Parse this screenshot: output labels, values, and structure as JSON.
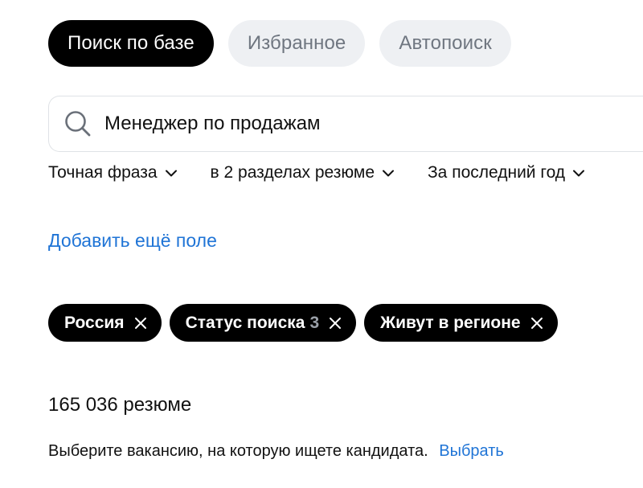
{
  "tabs": [
    {
      "label": "Поиск по базе",
      "active": true
    },
    {
      "label": "Избранное",
      "active": false
    },
    {
      "label": "Автопоиск",
      "active": false
    }
  ],
  "search": {
    "value": "Менеджер по продажам",
    "icon": "search-icon"
  },
  "filters": [
    {
      "label": "Точная фраза",
      "icon": "chevron-down-icon"
    },
    {
      "label": "в 2 разделах резюме",
      "icon": "chevron-down-icon"
    },
    {
      "label": "За последний год",
      "icon": "chevron-down-icon"
    }
  ],
  "add_field_label": "Добавить ещё поле",
  "chips": [
    {
      "label": "Россия",
      "count": ""
    },
    {
      "label": "Статус поиска",
      "count": "3"
    },
    {
      "label": "Живут в регионе",
      "count": ""
    }
  ],
  "results_count": "165 036 резюме",
  "vacancy": {
    "text": "Выберите вакансию, на которую ищете кандидата.",
    "link_label": "Выбрать"
  },
  "colors": {
    "accent": "#1f74d6",
    "active_tab": "#000000",
    "inactive_tab_bg": "#eef0f3",
    "inactive_tab_text": "#6f7680"
  }
}
